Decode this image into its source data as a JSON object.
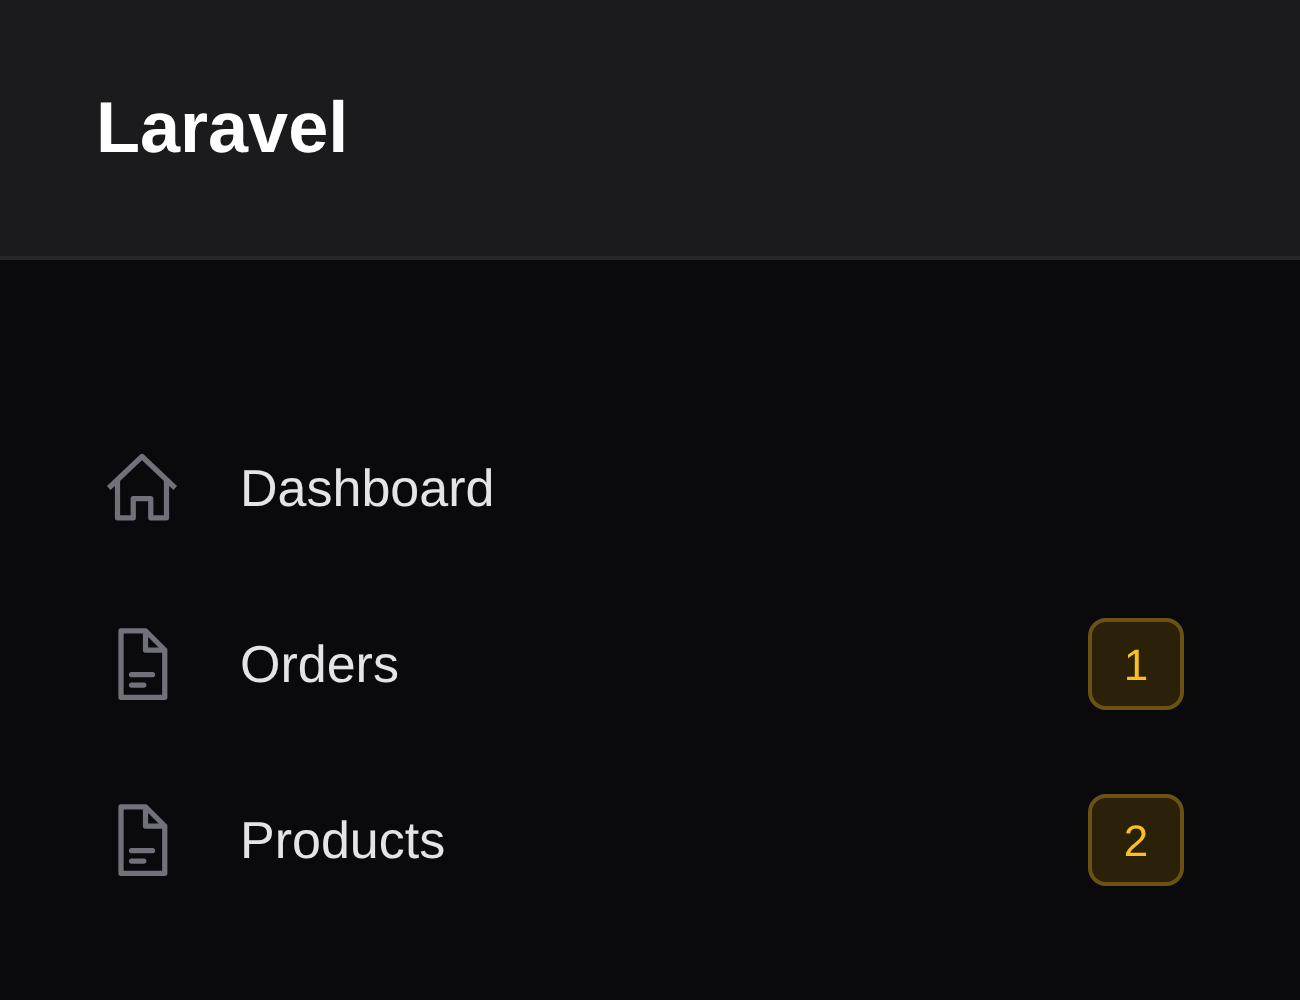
{
  "brand": "Laravel",
  "nav": [
    {
      "label": "Dashboard",
      "kind": "home"
    },
    {
      "label": "Orders",
      "kind": "document",
      "badge": "1"
    },
    {
      "label": "Products",
      "kind": "document",
      "badge": "2"
    }
  ]
}
